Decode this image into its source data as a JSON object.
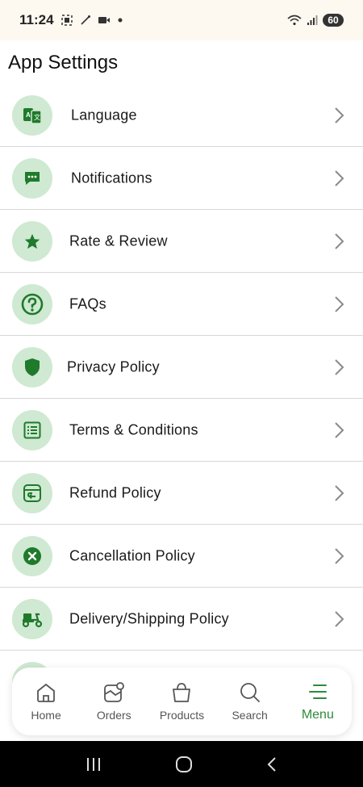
{
  "status_bar": {
    "time": "11:24",
    "battery": "60"
  },
  "header": {
    "title": "App Settings"
  },
  "settings": [
    {
      "label": "Language",
      "icon": "translate-icon"
    },
    {
      "label": "Notifications",
      "icon": "chat-bubble-icon"
    },
    {
      "label": "Rate & Review",
      "icon": "star-icon"
    },
    {
      "label": "FAQs",
      "icon": "question-icon"
    },
    {
      "label": "Privacy Policy",
      "icon": "shield-icon"
    },
    {
      "label": "Terms & Conditions",
      "icon": "list-icon"
    },
    {
      "label": "Refund Policy",
      "icon": "refund-icon"
    },
    {
      "label": "Cancellation Policy",
      "icon": "cancel-icon"
    },
    {
      "label": "Delivery/Shipping Policy",
      "icon": "scooter-icon"
    }
  ],
  "bottom_nav": [
    {
      "label": "Home",
      "icon": "home-icon"
    },
    {
      "label": "Orders",
      "icon": "orders-icon"
    },
    {
      "label": "Products",
      "icon": "bag-icon"
    },
    {
      "label": "Search",
      "icon": "search-icon"
    },
    {
      "label": "Menu",
      "icon": "menu-icon",
      "active": true
    }
  ],
  "colors": {
    "accent": "#1f7a2b",
    "icon_bg": "#cfe9d2",
    "active": "#2e8b3b"
  }
}
